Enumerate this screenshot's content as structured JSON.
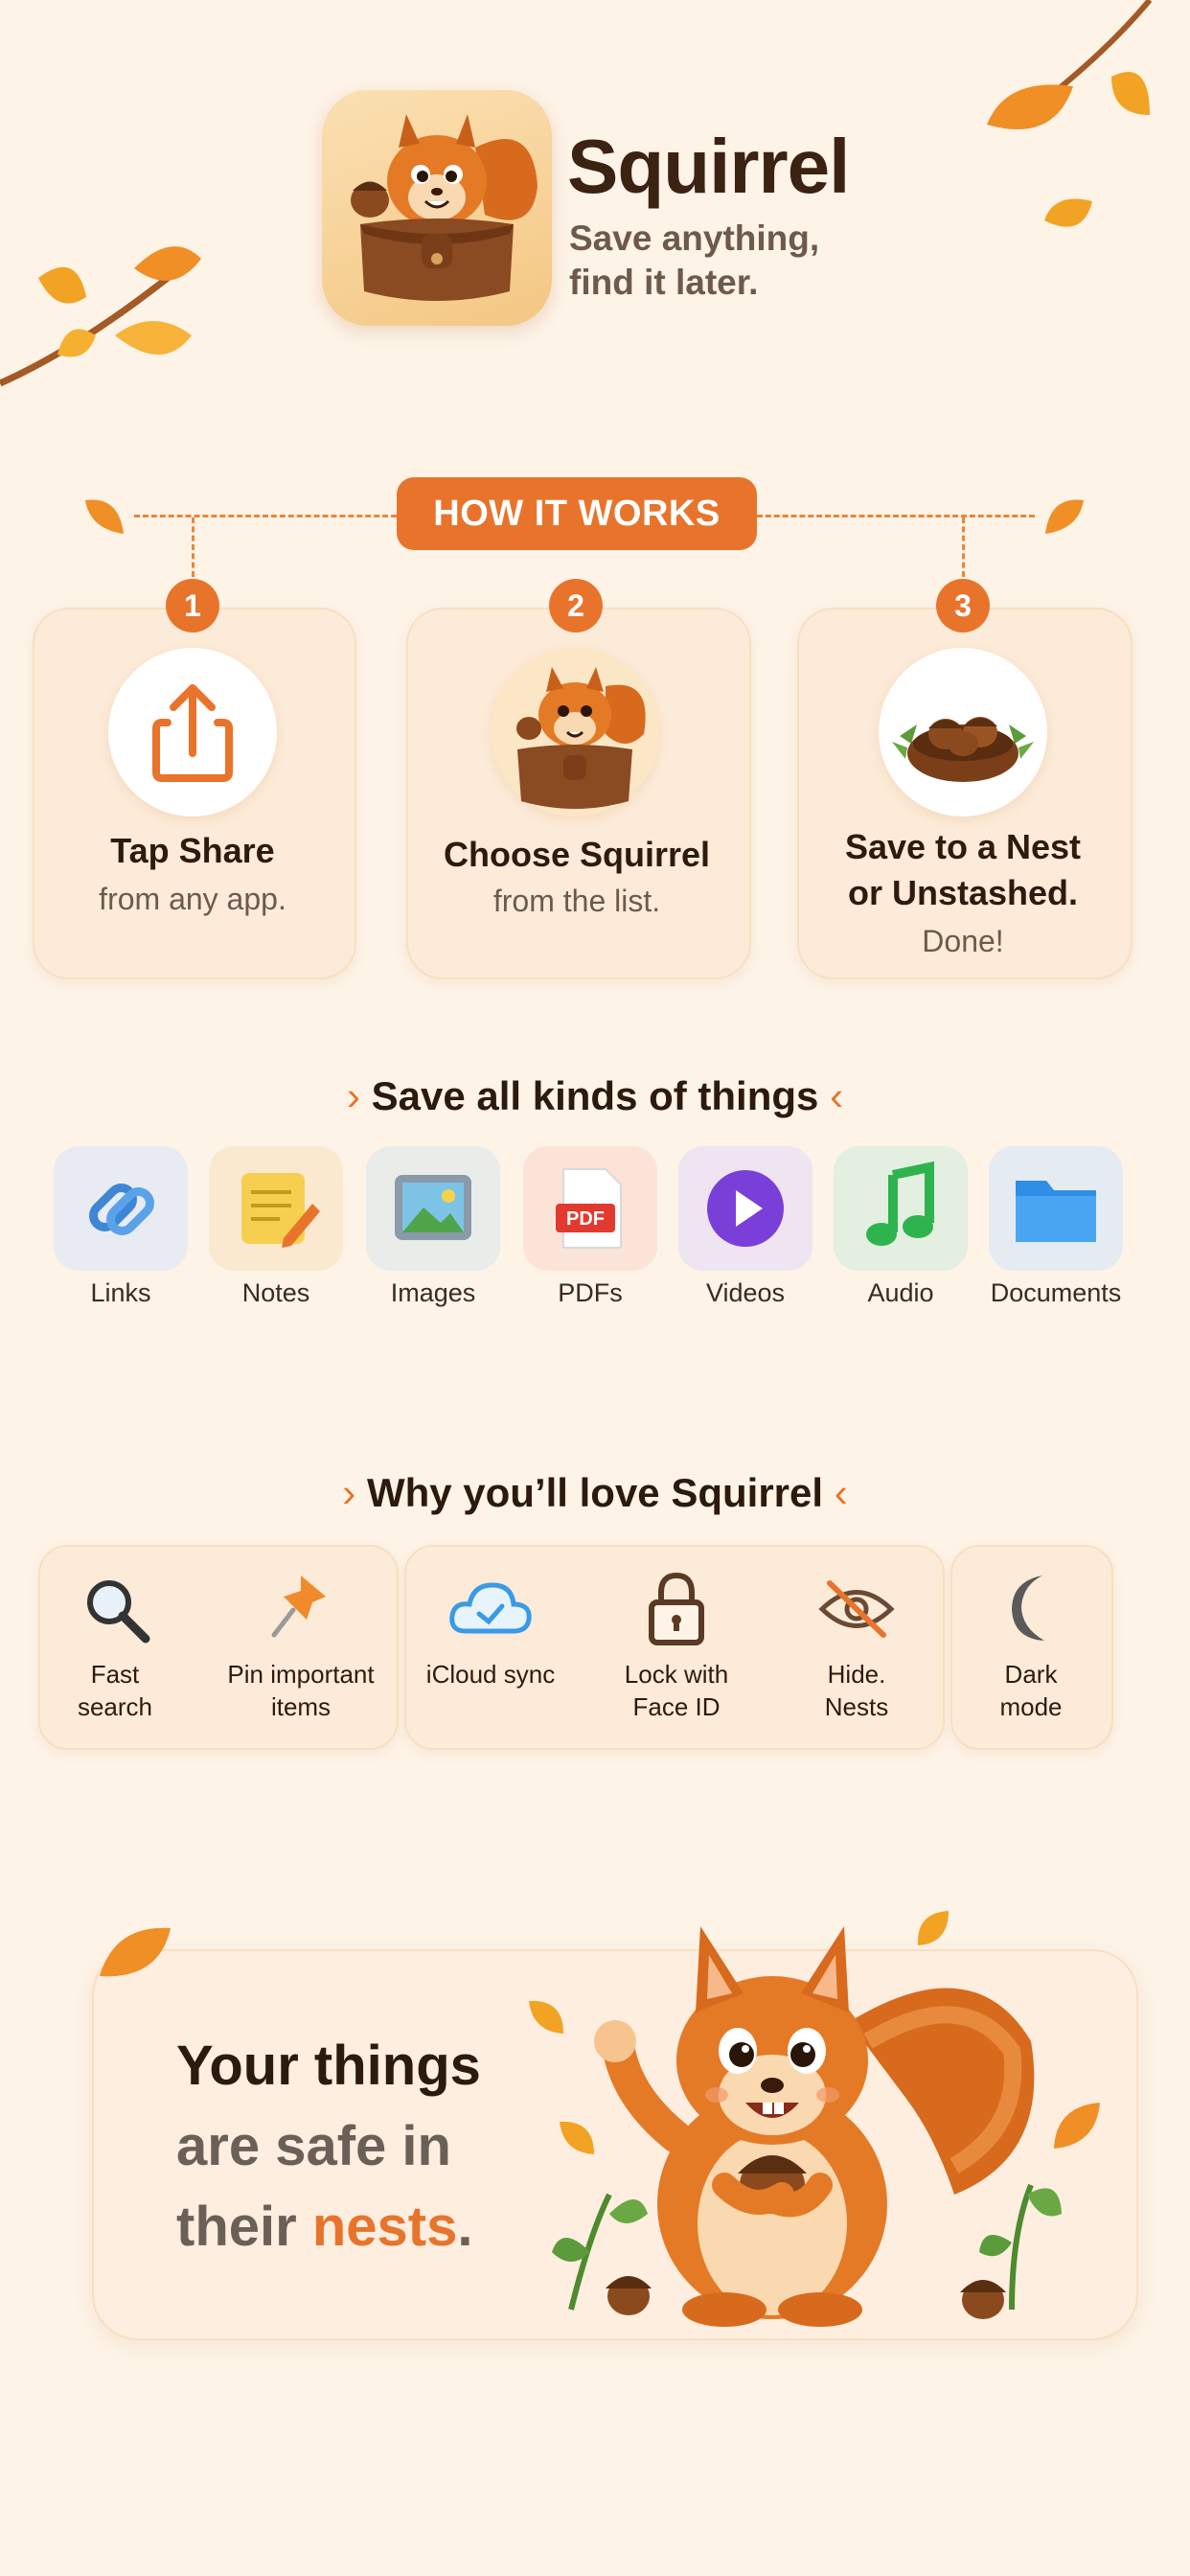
{
  "header": {
    "app_name": "Squirrel",
    "tagline_line1": "Save anything,",
    "tagline_line2": "find it later."
  },
  "how_it_works": {
    "heading": "HOW IT WORKS",
    "steps": [
      {
        "number": "1",
        "title": "Tap Share",
        "subtitle": "from any app.",
        "icon": "share-icon"
      },
      {
        "number": "2",
        "title": "Choose Squirrel",
        "subtitle": "from the list.",
        "icon": "squirrel-icon"
      },
      {
        "number": "3",
        "title_line1": "Save to a Nest",
        "title_line2": "or Unstashed.",
        "subtitle": "Done!",
        "icon": "nest-icon"
      }
    ]
  },
  "content_types": {
    "heading": "Save all kinds of things",
    "items": [
      {
        "label": "Links",
        "icon": "link-icon",
        "tile_color": "#e8ecf2"
      },
      {
        "label": "Notes",
        "icon": "note-icon",
        "tile_color": "#fbe9cf"
      },
      {
        "label": "Images",
        "icon": "image-icon",
        "tile_color": "#e9ece8"
      },
      {
        "label": "PDFs",
        "icon": "pdf-icon",
        "tile_color": "#fce3d8"
      },
      {
        "label": "Videos",
        "icon": "play-icon",
        "tile_color": "#eee4f2"
      },
      {
        "label": "Audio",
        "icon": "music-note-icon",
        "tile_color": "#e3efe0"
      },
      {
        "label": "Documents",
        "icon": "folder-icon",
        "tile_color": "#e4ecf2"
      }
    ]
  },
  "features": {
    "heading": "Why you’ll love Squirrel",
    "items": [
      {
        "line1": "Fast",
        "line2": "search",
        "icon": "magnifier-icon"
      },
      {
        "line1": "Pin important",
        "line2": "items",
        "icon": "pin-icon"
      },
      {
        "line1": "iCloud sync",
        "line2": "",
        "icon": "cloud-icon"
      },
      {
        "line1": "Lock with",
        "line2": "Face ID",
        "icon": "lock-icon"
      },
      {
        "line1": "Hide.",
        "line2": "Nests",
        "icon": "eye-off-icon"
      },
      {
        "line1": "Dark",
        "line2": "mode",
        "icon": "moon-icon"
      }
    ]
  },
  "banner": {
    "line1": "Your things",
    "line2": "are safe in",
    "line3_prefix": "their ",
    "line3_accent": "nests",
    "line3_suffix": "."
  },
  "colors": {
    "accent": "#e8742c",
    "background": "#fdf3e7",
    "text_dark": "#2c1a0e"
  }
}
